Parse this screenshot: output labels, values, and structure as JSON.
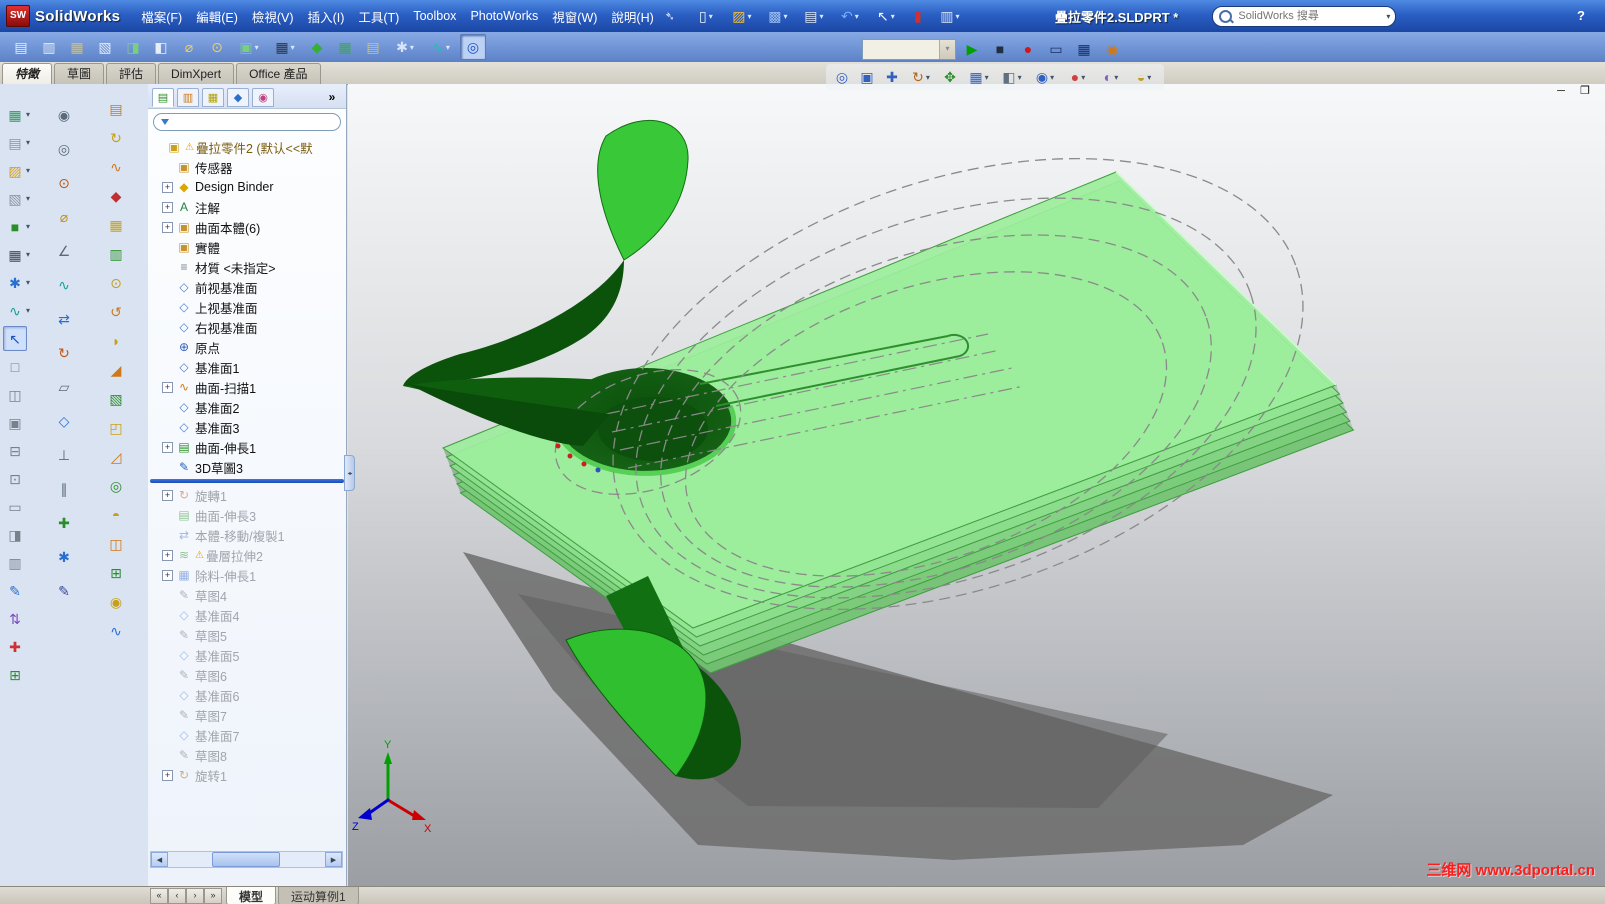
{
  "titlebar": {
    "logo_text": "SW",
    "app_name": "SolidWorks",
    "document_title": "疊拉零件2.SLDPRT *",
    "search_placeholder": "SolidWorks 搜尋",
    "search_arrow": "▾",
    "pin_glyph": "➴",
    "help_label": "?",
    "menus": [
      {
        "label": "檔案(F)",
        "name": "menu-file"
      },
      {
        "label": "編輯(E)",
        "name": "menu-edit"
      },
      {
        "label": "檢視(V)",
        "name": "menu-view"
      },
      {
        "label": "插入(I)",
        "name": "menu-insert"
      },
      {
        "label": "工具(T)",
        "name": "menu-tools"
      },
      {
        "label": "Toolbox",
        "name": "menu-toolbox"
      },
      {
        "label": "PhotoWorks",
        "name": "menu-photoworks"
      },
      {
        "label": "視窗(W)",
        "name": "menu-window"
      },
      {
        "label": "說明(H)",
        "name": "menu-help"
      }
    ],
    "quick_icons": [
      {
        "name": "new-document-icon",
        "glyph": "▯",
        "color": "#f2f6fc",
        "arrow": true
      },
      {
        "name": "open-document-icon",
        "glyph": "▨",
        "color": "#f0c040",
        "arrow": true
      },
      {
        "name": "save-icon",
        "glyph": "▩",
        "color": "#9cc0f0",
        "arrow": true
      },
      {
        "name": "print-icon",
        "glyph": "▤",
        "color": "#dce4f2",
        "arrow": true
      },
      {
        "name": "undo-icon",
        "glyph": "↶",
        "color": "#70b0ff",
        "arrow": true
      },
      {
        "name": "select-cursor-icon",
        "glyph": "↖",
        "color": "#f0f4fc",
        "arrow": true
      },
      {
        "name": "rebuild-icon",
        "glyph": "▮",
        "color": "#d03030"
      },
      {
        "name": "options-icon",
        "glyph": "▥",
        "color": "#dce4f2",
        "arrow": true
      }
    ]
  },
  "toolbar2": {
    "left_icons": [
      {
        "name": "make-drawing-icon",
        "glyph": "▤",
        "color": "#e8edf6"
      },
      {
        "name": "make-assembly-icon",
        "glyph": "▥",
        "color": "#e8edf6"
      },
      {
        "name": "publish-edrawing-icon",
        "glyph": "▦",
        "color": "#e8c040"
      },
      {
        "name": "pack-and-go-icon",
        "glyph": "▧",
        "color": "#e8edf6"
      },
      {
        "name": "curvature-icon",
        "glyph": "◨",
        "color": "#78d078"
      },
      {
        "name": "section-view-icon",
        "glyph": "◧",
        "color": "#e8edf6"
      },
      {
        "name": "measure-icon",
        "glyph": "⌀",
        "color": "#f0d060"
      },
      {
        "name": "mass-properties-icon",
        "glyph": "⊙",
        "color": "#f0d060"
      },
      {
        "name": "materials-flyout",
        "glyph": "▣",
        "color": "#78d078",
        "arrow": true
      },
      {
        "name": "grid-flyout",
        "glyph": "▦",
        "color": "#2a3548",
        "arrow": true
      },
      {
        "name": "equations-icon",
        "glyph": "◆",
        "color": "#35b035"
      },
      {
        "name": "design-table-icon",
        "glyph": "▦",
        "color": "#35b035"
      },
      {
        "name": "publish-icon",
        "glyph": "▤",
        "color": "#e8c040"
      },
      {
        "name": "snap-flyout",
        "glyph": "✱",
        "color": "#d8e4f8",
        "arrow": true
      },
      {
        "name": "spline-flyout",
        "glyph": "∿",
        "color": "#20c0b0",
        "arrow": true
      },
      {
        "name": "measure-pressed-icon",
        "glyph": "◎",
        "color": "#1a50c0",
        "pressed": true
      }
    ],
    "right_icons": [
      {
        "name": "play-button",
        "glyph": "▶",
        "color": "#00a000"
      },
      {
        "name": "stop-button",
        "glyph": "■",
        "color": "#203040"
      },
      {
        "name": "record-button",
        "glyph": "●",
        "color": "#d01818"
      },
      {
        "name": "render-window-icon",
        "glyph": "▭",
        "color": "#16306a"
      },
      {
        "name": "render-chart-icon",
        "glyph": "▦",
        "color": "#16306a"
      },
      {
        "name": "render-colors-icon",
        "glyph": "◉",
        "color": "#d07818"
      }
    ],
    "combo_value": ""
  },
  "command_tabs": [
    {
      "label": "特徵",
      "name": "tab-features",
      "active": true
    },
    {
      "label": "草圖",
      "name": "tab-sketch"
    },
    {
      "label": "評估",
      "name": "tab-evaluate"
    },
    {
      "label": "DimXpert",
      "name": "tab-dimxpert"
    },
    {
      "label": "Office 產品",
      "name": "tab-office-products"
    }
  ],
  "left_toolbars": {
    "col1": [
      {
        "name": "design-library-flyout",
        "glyph": "▦",
        "color": "#2a9a5a",
        "arrow": true
      },
      {
        "name": "file-explorer-flyout",
        "glyph": "▤",
        "color": "#8a94a4",
        "arrow": true
      },
      {
        "name": "appearances-flyout",
        "glyph": "▨",
        "color": "#d8a020",
        "arrow": true
      },
      {
        "name": "scenes-flyout",
        "glyph": "▧",
        "color": "#8a94a4",
        "arrow": true
      },
      {
        "name": "solid-model-flyout",
        "glyph": "■",
        "color": "#2a8f2a",
        "arrow": true
      },
      {
        "name": "pattern-grid-flyout",
        "glyph": "▦",
        "color": "#404858",
        "arrow": true
      },
      {
        "name": "reference-star-flyout",
        "glyph": "✱",
        "color": "#2a6fd0",
        "arrow": true
      },
      {
        "name": "spline-flyout",
        "glyph": "∿",
        "color": "#18a098",
        "arrow": true
      },
      {
        "name": "select-tool",
        "glyph": "↖",
        "color": "#1a50c0",
        "pressed": true
      },
      {
        "name": "viewport-single-icon",
        "glyph": "□",
        "color": "#78808c"
      },
      {
        "name": "viewport-two-icon",
        "glyph": "◫",
        "color": "#78808c"
      },
      {
        "name": "viewport-four-icon",
        "glyph": "▣",
        "color": "#78808c"
      },
      {
        "name": "viewport-horizontal-icon",
        "glyph": "⊟",
        "color": "#78808c"
      },
      {
        "name": "viewport-vertical-icon",
        "glyph": "⊡",
        "color": "#78808c"
      },
      {
        "name": "viewport-link-icon",
        "glyph": "▭",
        "color": "#78808c"
      },
      {
        "name": "viewport-preview-icon",
        "glyph": "◨",
        "color": "#78808c"
      },
      {
        "name": "viewport-page-icon",
        "glyph": "▥",
        "color": "#78808c"
      },
      {
        "name": "annotation-pencil-tool",
        "glyph": "✎",
        "color": "#2a6fd0"
      },
      {
        "name": "swap-vertical-tool",
        "glyph": "⇅",
        "color": "#7a4ac0"
      },
      {
        "name": "add-relation-tool",
        "glyph": "✚",
        "color": "#d03030"
      },
      {
        "name": "grid-system-tool",
        "glyph": "⊞",
        "color": "#2a8f2a"
      }
    ],
    "col2": [
      {
        "name": "circle-sketch-tool",
        "glyph": "◉",
        "color": "#5a6a7a"
      },
      {
        "name": "grab-tool",
        "glyph": "◎",
        "color": "#5a6a7a"
      },
      {
        "name": "anchor-tool",
        "glyph": "⊙",
        "color": "#c05818"
      },
      {
        "name": "dimension-tool",
        "glyph": "⌀",
        "color": "#c09018"
      },
      {
        "name": "angle-tool",
        "glyph": "∠",
        "color": "#5a6a7a"
      },
      {
        "name": "spline-tool",
        "glyph": "∿",
        "color": "#18a098"
      },
      {
        "name": "mirror-tool",
        "glyph": "⇄",
        "color": "#2a6fd0"
      },
      {
        "name": "rotate-tool",
        "glyph": "↻",
        "color": "#c05818"
      },
      {
        "name": "polygon-tool",
        "glyph": "▱",
        "color": "#5a6a7a"
      },
      {
        "name": "plane-tool",
        "glyph": "◇",
        "color": "#2a6fd0"
      },
      {
        "name": "perpendicular-tool",
        "glyph": "⊥",
        "color": "#5a6a7a"
      },
      {
        "name": "parallel-tool",
        "glyph": "∥",
        "color": "#5a6a7a"
      },
      {
        "name": "add-point-tool",
        "glyph": "✚",
        "color": "#2a8f2a"
      },
      {
        "name": "star-tool",
        "glyph": "✱",
        "color": "#2a6fd0"
      },
      {
        "name": "pencil-tool",
        "glyph": "✎",
        "color": "#3a4a9a"
      }
    ],
    "col3": [
      {
        "name": "extrude-boss-icon",
        "glyph": "▤",
        "color": "#d07818"
      },
      {
        "name": "revolve-boss-icon",
        "glyph": "↻",
        "color": "#c8a018"
      },
      {
        "name": "swept-boss-icon",
        "glyph": "∿",
        "color": "#d07818"
      },
      {
        "name": "lofted-boss-icon",
        "glyph": "◆",
        "color": "#c03030"
      },
      {
        "name": "boundary-boss-icon",
        "glyph": "▦",
        "color": "#c8a018"
      },
      {
        "name": "extrude-cut-icon",
        "glyph": "▥",
        "color": "#2a8f2a"
      },
      {
        "name": "hole-wizard-icon",
        "glyph": "⊙",
        "color": "#c8a018"
      },
      {
        "name": "revolve-cut-icon",
        "glyph": "↺",
        "color": "#d07818"
      },
      {
        "name": "fillet-icon",
        "glyph": "◗",
        "color": "#c8a018"
      },
      {
        "name": "chamfer-icon",
        "glyph": "◢",
        "color": "#d07818"
      },
      {
        "name": "rib-icon",
        "glyph": "▧",
        "color": "#2a8f2a"
      },
      {
        "name": "shell-icon",
        "glyph": "◰",
        "color": "#c8a018"
      },
      {
        "name": "draft-icon",
        "glyph": "◿",
        "color": "#d07818"
      },
      {
        "name": "wrap-icon",
        "glyph": "◎",
        "color": "#2a8f2a"
      },
      {
        "name": "dome-icon",
        "glyph": "◓",
        "color": "#c8a018"
      },
      {
        "name": "mirror-feature-icon",
        "glyph": "◫",
        "color": "#d07818"
      },
      {
        "name": "linear-pattern-icon",
        "glyph": "⊞",
        "color": "#2a8f2a"
      },
      {
        "name": "circular-pattern-icon",
        "glyph": "◉",
        "color": "#c8a018"
      },
      {
        "name": "curve-icon",
        "glyph": "∿",
        "color": "#2a6fd0"
      }
    ]
  },
  "panel": {
    "mini_tabs": [
      {
        "name": "featuremanager-tree-tab",
        "glyph": "▤",
        "color": "#2a8f2a",
        "active": true
      },
      {
        "name": "propertymanager-tab",
        "glyph": "▥",
        "color": "#d07818"
      },
      {
        "name": "configurationmanager-tab",
        "glyph": "▦",
        "color": "#b0a000"
      },
      {
        "name": "dimxpertmanager-tab",
        "glyph": "◆",
        "color": "#2a6fd0"
      },
      {
        "name": "displaymanager-tab",
        "glyph": "◉",
        "color": "#c04080"
      }
    ],
    "overflow_glyph": "»",
    "splitter_glyph": "◂▸",
    "root": {
      "label": "疊拉零件2 (默认<<默",
      "glyph": "▣",
      "color": "#caa21a",
      "warning": true
    },
    "items_before": [
      {
        "label": "传感器",
        "glyph": "▣",
        "color": "#c8922a",
        "name": "sensors-folder"
      },
      {
        "label": "Design Binder",
        "glyph": "◆",
        "color": "#d8a800",
        "expand": true,
        "name": "design-binder"
      },
      {
        "label": "注解",
        "glyph": "A",
        "color": "#208040",
        "expand": true,
        "name": "annotations-folder"
      },
      {
        "label": "曲面本體(6)",
        "glyph": "▣",
        "color": "#c8922a",
        "expand": true,
        "name": "surface-bodies-folder"
      },
      {
        "label": "實體",
        "glyph": "▣",
        "color": "#c8922a",
        "name": "solid-bodies-folder"
      },
      {
        "label": "材質 <未指定>",
        "glyph": "≡",
        "color": "#7a8694",
        "name": "material"
      },
      {
        "label": "前视基准面",
        "glyph": "◇",
        "color": "#4a7fd4",
        "name": "front-plane"
      },
      {
        "label": "上视基准面",
        "glyph": "◇",
        "color": "#4a7fd4",
        "name": "top-plane"
      },
      {
        "label": "右视基准面",
        "glyph": "◇",
        "color": "#4a7fd4",
        "name": "right-plane"
      },
      {
        "label": "原点",
        "glyph": "⊕",
        "color": "#3060c0",
        "name": "origin"
      },
      {
        "label": "基准面1",
        "glyph": "◇",
        "color": "#4a7fd4",
        "name": "plane1"
      },
      {
        "label": "曲面-扫描1",
        "glyph": "∿",
        "color": "#d07818",
        "expand": true,
        "name": "surface-sweep1"
      },
      {
        "label": "基准面2",
        "glyph": "◇",
        "color": "#4a7fd4",
        "name": "plane2"
      },
      {
        "label": "基准面3",
        "glyph": "◇",
        "color": "#4a7fd4",
        "name": "plane3"
      },
      {
        "label": "曲面-伸長1",
        "glyph": "▤",
        "color": "#2a8f2a",
        "expand": true,
        "name": "surface-extrude1"
      },
      {
        "label": "3D草圖3",
        "glyph": "✎",
        "color": "#2060c0",
        "name": "3d-sketch3"
      }
    ],
    "items_after": [
      {
        "label": "旋轉1",
        "glyph": "↻",
        "color": "#b06818",
        "expand": true,
        "grayed": true,
        "name": "revolve1"
      },
      {
        "label": "曲面-伸長3",
        "glyph": "▤",
        "color": "#2a8f2a",
        "grayed": true,
        "name": "surface-extrude3"
      },
      {
        "label": "本體-移動/複製1",
        "glyph": "⇄",
        "color": "#4a7fd4",
        "grayed": true,
        "name": "body-move-copy1"
      },
      {
        "label": "疊層拉伸2",
        "glyph": "≋",
        "color": "#2a8f2a",
        "expand": true,
        "warning": true,
        "grayed": true,
        "name": "loft2"
      },
      {
        "label": "除料-伸長1",
        "glyph": "▦",
        "color": "#3a6fd0",
        "expand": true,
        "grayed": true,
        "name": "cut-extrude1"
      },
      {
        "label": "草图4",
        "glyph": "✎",
        "color": "#607080",
        "grayed": true,
        "name": "sketch4"
      },
      {
        "label": "基准面4",
        "glyph": "◇",
        "color": "#4a7fd4",
        "grayed": true,
        "name": "plane4"
      },
      {
        "label": "草图5",
        "glyph": "✎",
        "color": "#607080",
        "grayed": true,
        "name": "sketch5"
      },
      {
        "label": "基准面5",
        "glyph": "◇",
        "color": "#4a7fd4",
        "grayed": true,
        "name": "plane5"
      },
      {
        "label": "草图6",
        "glyph": "✎",
        "color": "#607080",
        "grayed": true,
        "name": "sketch6"
      },
      {
        "label": "基准面6",
        "glyph": "◇",
        "color": "#4a7fd4",
        "grayed": true,
        "name": "plane6"
      },
      {
        "label": "草图7",
        "glyph": "✎",
        "color": "#607080",
        "grayed": true,
        "name": "sketch7"
      },
      {
        "label": "基准面7",
        "glyph": "◇",
        "color": "#4a7fd4",
        "grayed": true,
        "name": "plane7"
      },
      {
        "label": "草图8",
        "glyph": "✎",
        "color": "#607080",
        "grayed": true,
        "name": "sketch8"
      },
      {
        "label": "旋转1",
        "glyph": "↻",
        "color": "#b06818",
        "expand": true,
        "grayed": true,
        "name": "revolve1-bottom"
      }
    ]
  },
  "view_toolbar": [
    {
      "name": "zoom-fit-icon",
      "glyph": "◎",
      "color": "#3060c0"
    },
    {
      "name": "zoom-area-icon",
      "glyph": "▣",
      "color": "#3060c0"
    },
    {
      "name": "zoom-in-out-icon",
      "glyph": "✚",
      "color": "#3060c0"
    },
    {
      "name": "rotate-view-icon",
      "glyph": "↻",
      "color": "#b06818",
      "arrow": true
    },
    {
      "name": "pan-icon",
      "glyph": "✥",
      "color": "#2a8f2a"
    },
    {
      "name": "view-orientation-icon",
      "glyph": "▦",
      "color": "#3060c0",
      "arrow": true
    },
    {
      "name": "display-style-icon",
      "glyph": "◧",
      "color": "#607080",
      "arrow": true
    },
    {
      "name": "hide-show-items-icon",
      "glyph": "◉",
      "color": "#3060c0",
      "arrow": true
    },
    {
      "name": "edit-appearance-icon",
      "glyph": "●",
      "color": "#d04040",
      "arrow": true
    },
    {
      "name": "apply-scene-icon",
      "glyph": "◐",
      "color": "#8060c0",
      "arrow": true
    },
    {
      "name": "view-settings-icon",
      "glyph": "◒",
      "color": "#c0a020",
      "arrow": true
    }
  ],
  "viewport": {
    "minimize_glyph": "─",
    "restore_glyph": "❐",
    "watermark": "三维网 www.3dportal.cn"
  },
  "statusbar": {
    "nav": [
      {
        "name": "tab-scroll-first",
        "glyph": "«"
      },
      {
        "name": "tab-scroll-prev",
        "glyph": "‹"
      },
      {
        "name": "tab-scroll-next",
        "glyph": "›"
      },
      {
        "name": "tab-scroll-last",
        "glyph": "»"
      }
    ],
    "tabs": [
      {
        "label": "模型",
        "name": "model-tab",
        "active": true
      },
      {
        "label": "运动算例1",
        "name": "motion-study-tab"
      }
    ]
  }
}
